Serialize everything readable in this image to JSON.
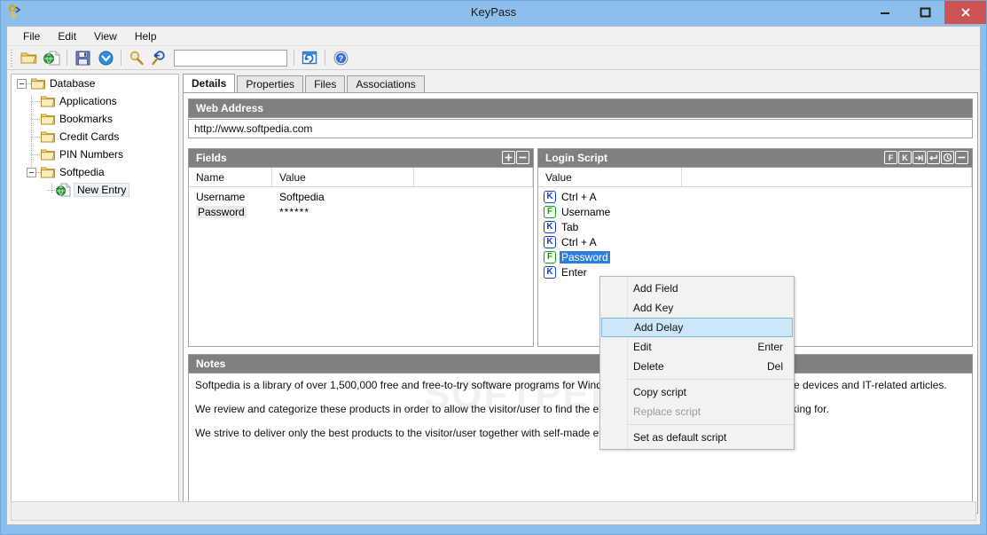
{
  "window": {
    "title": "KeyPass",
    "app_icon": "key-icon",
    "buttons": {
      "minimize": "minimize-icon",
      "maximize": "maximize-icon",
      "close": "close-icon"
    }
  },
  "menubar": {
    "items": [
      "File",
      "Edit",
      "View",
      "Help"
    ]
  },
  "toolbar": {
    "icons": [
      "open-folder-icon",
      "new-web-entry-icon",
      "save-icon",
      "download-icon",
      "search-icon",
      "find-next-icon",
      "refresh-icon",
      "help-icon"
    ],
    "search_value": "",
    "search_placeholder": ""
  },
  "tree": {
    "root": "Database",
    "items": [
      {
        "label": "Database",
        "icon": "folder-icon",
        "level": 0,
        "expanded": true
      },
      {
        "label": "Applications",
        "icon": "folder-icon",
        "level": 1
      },
      {
        "label": "Bookmarks",
        "icon": "folder-icon",
        "level": 1
      },
      {
        "label": "Credit Cards",
        "icon": "folder-icon",
        "level": 1
      },
      {
        "label": "PIN Numbers",
        "icon": "folder-icon",
        "level": 1
      },
      {
        "label": "Softpedia",
        "icon": "folder-icon",
        "level": 1,
        "expanded": true
      },
      {
        "label": "New Entry",
        "icon": "globe-page-icon",
        "level": 2,
        "selected": true
      }
    ]
  },
  "tabs": [
    {
      "label": "Details",
      "active": true
    },
    {
      "label": "Properties",
      "active": false
    },
    {
      "label": "Files",
      "active": false
    },
    {
      "label": "Associations",
      "active": false
    }
  ],
  "web_address": {
    "header": "Web Address",
    "value": "http://www.softpedia.com"
  },
  "fields_panel": {
    "header": "Fields",
    "buttons": [
      "add-field-button",
      "remove-field-button"
    ],
    "columns": [
      "Name",
      "Value"
    ],
    "rows": [
      {
        "name": "Username",
        "value": "Softpedia",
        "highlighted": false
      },
      {
        "name": "Password",
        "value": "******",
        "highlighted": true
      }
    ]
  },
  "login_script_panel": {
    "header": "Login Script",
    "buttons": [
      "add-field-button",
      "add-key-button",
      "add-tab-button",
      "add-enter-button",
      "add-delay-button",
      "remove-step-button"
    ],
    "columns": [
      "Value"
    ],
    "rows": [
      {
        "type": "K",
        "label": "Ctrl + A",
        "selected": false
      },
      {
        "type": "F",
        "label": "Username",
        "selected": false
      },
      {
        "type": "K",
        "label": "Tab",
        "selected": false
      },
      {
        "type": "K",
        "label": "Ctrl + A",
        "selected": false
      },
      {
        "type": "F",
        "label": "Password",
        "selected": true
      },
      {
        "type": "K",
        "label": "Enter",
        "selected": false
      }
    ]
  },
  "notes_panel": {
    "header": "Notes",
    "paragraphs": [
      "Softpedia is a library of over 1,500,000 free and free-to-try software programs for Windows, Mac, Linux, Windows drivers, mobile devices and IT-related articles.",
      "We review and categorize these products in order to allow the visitor/user to find the exact product and information they are looking for.",
      "We strive to deliver only the best products to the visitor/user together with self-made evaluations."
    ]
  },
  "watermark": {
    "text": "SOFTPEDIA",
    "mark": "®"
  },
  "context_menu": {
    "items": [
      {
        "label": "Add Field",
        "shortcut": "",
        "state": "normal"
      },
      {
        "label": "Add Key",
        "shortcut": "",
        "state": "normal"
      },
      {
        "label": "Add Delay",
        "shortcut": "",
        "state": "highlighted"
      },
      {
        "label": "Edit",
        "shortcut": "Enter",
        "state": "normal"
      },
      {
        "label": "Delete",
        "shortcut": "Del",
        "state": "normal"
      },
      {
        "separator": true
      },
      {
        "label": "Copy script",
        "shortcut": "",
        "state": "normal"
      },
      {
        "label": "Replace script",
        "shortcut": "",
        "state": "disabled"
      },
      {
        "separator": true
      },
      {
        "label": "Set as default script",
        "shortcut": "",
        "state": "normal"
      }
    ]
  },
  "colors": {
    "title_bar": "#8cbfec",
    "group_header": "#808080",
    "close_button": "#cc5454",
    "selection": "#2a7fe0",
    "menu_highlight": "#cce8f8",
    "key_badge": "#1a3fd0",
    "field_badge": "#13a013"
  }
}
